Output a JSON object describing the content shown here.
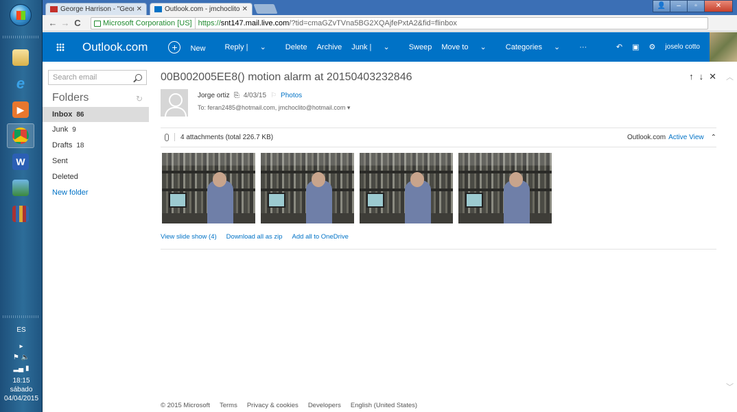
{
  "taskbar": {
    "language": "ES",
    "time": "18:15",
    "day": "sábado",
    "date": "04/04/2015"
  },
  "browser": {
    "tabs": [
      {
        "title": "George Harrison - \"Georg",
        "active": false
      },
      {
        "title": "Outlook.com - jmchoclito",
        "active": true
      }
    ],
    "ev_cert": "Microsoft Corporation [US]",
    "url_scheme": "https://",
    "url_host": "snt147.mail.live.com",
    "url_path": "/?tid=cmaGZvTVna5BG2XQAjfePxtA2&fid=flinbox"
  },
  "header": {
    "brand": "Outlook.com",
    "commands": [
      "New",
      "Reply |",
      "Delete",
      "Archive",
      "Junk |",
      "Sweep",
      "Move to",
      "Categories",
      "···"
    ],
    "user_name": "joselo cotto"
  },
  "sidebar": {
    "search_placeholder": "Search email",
    "folders_title": "Folders",
    "folders": [
      {
        "label": "Inbox",
        "count": "86",
        "selected": true
      },
      {
        "label": "Junk",
        "count": "9",
        "selected": false
      },
      {
        "label": "Drafts",
        "count": "18",
        "selected": false
      },
      {
        "label": "Sent",
        "count": "",
        "selected": false
      },
      {
        "label": "Deleted",
        "count": "",
        "selected": false
      }
    ],
    "new_folder": "New folder"
  },
  "message": {
    "subject": "00B002005EE8() motion alarm at 20150403232846",
    "sender": "Jorge ortiz",
    "date": "4/03/15",
    "category": "Photos",
    "to": "To: feran2485@hotmail.com, jmchoclito@hotmail.com",
    "attachments_summary": "4 attachments (total 226.7 KB)",
    "active_view_prefix": "Outlook.com",
    "active_view_link": "Active View",
    "attachment_count": 4,
    "actions": [
      "View slide show (4)",
      "Download all as zip",
      "Add all to OneDrive"
    ]
  },
  "footer": [
    "© 2015 Microsoft",
    "Terms",
    "Privacy & cookies",
    "Developers",
    "English (United States)"
  ],
  "colors": {
    "brand_blue": "#0072c6",
    "selected_folder_bg": "#dcdcdc"
  }
}
